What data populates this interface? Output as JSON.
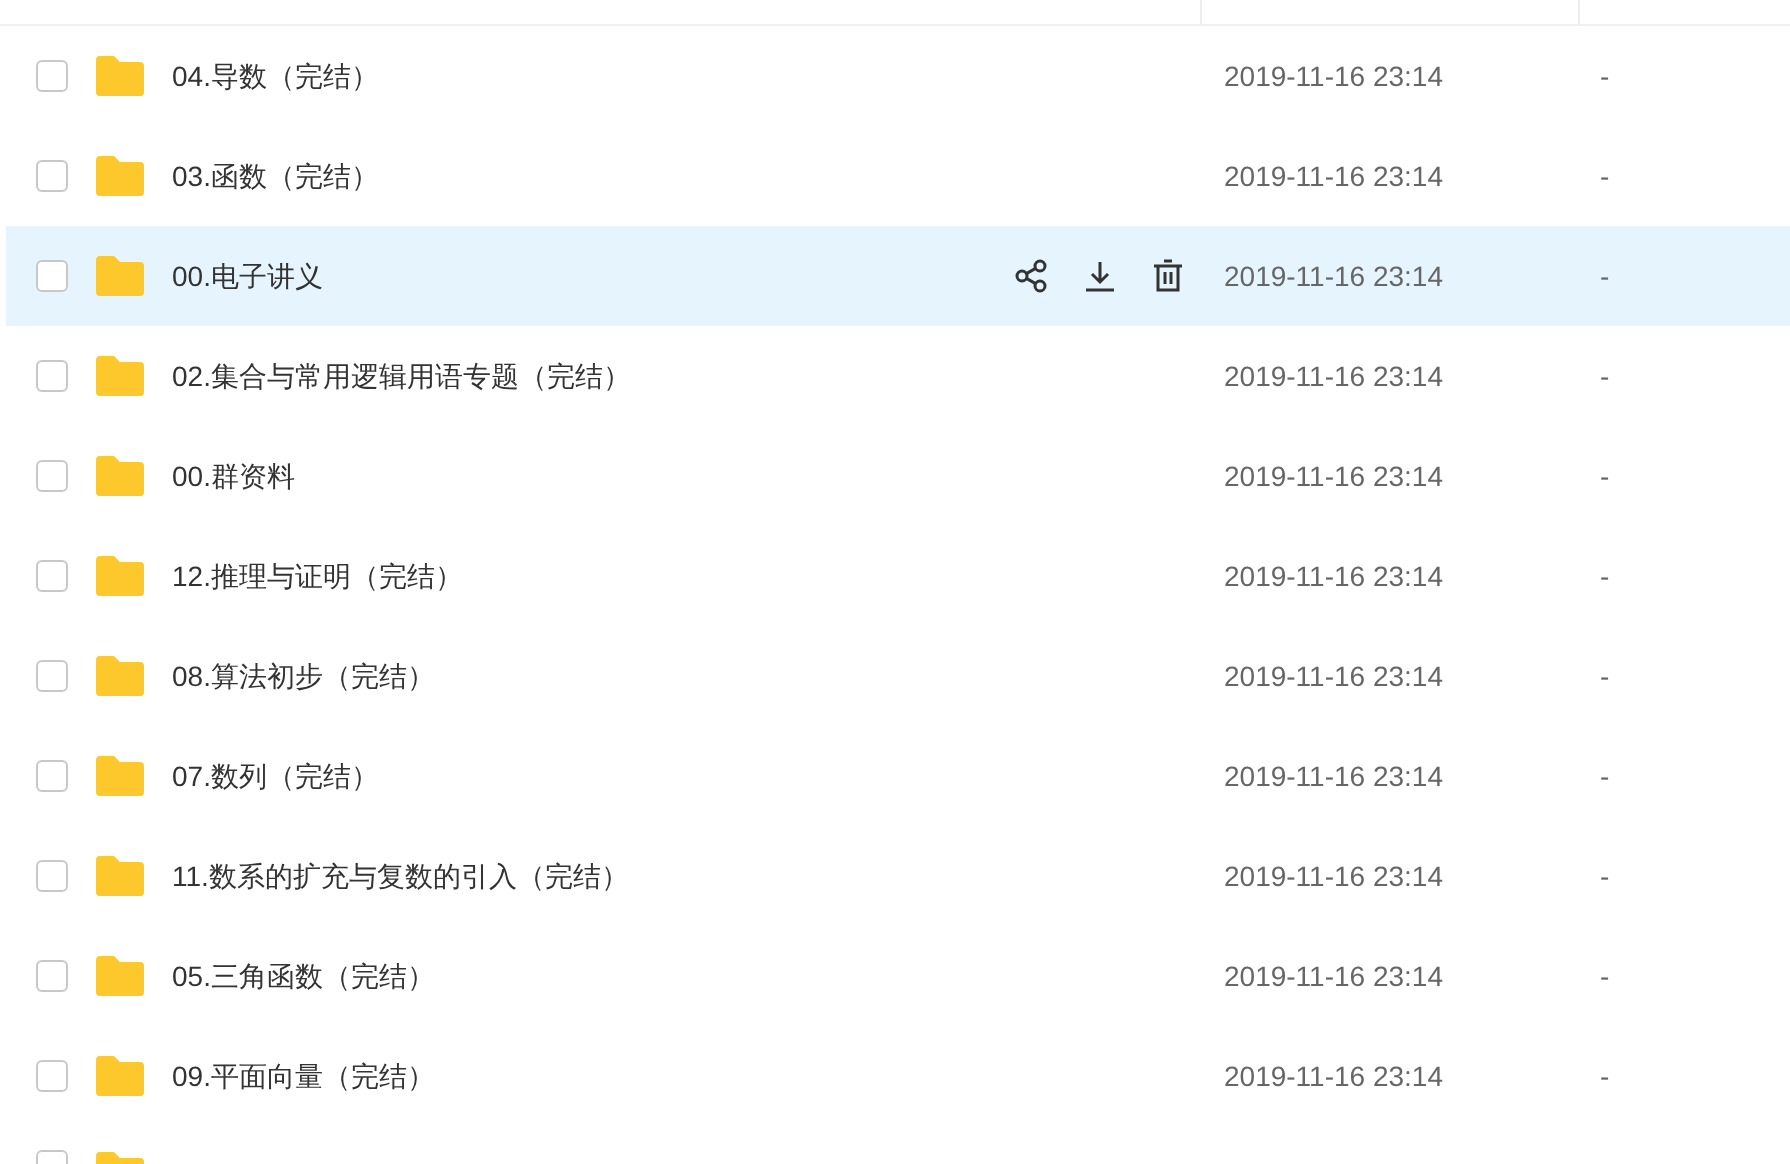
{
  "rows": [
    {
      "name": "04.导数（完结）",
      "modified": "2019-11-16 23:14",
      "size": "-",
      "checked": false,
      "hovered": false
    },
    {
      "name": "03.函数（完结）",
      "modified": "2019-11-16 23:14",
      "size": "-",
      "checked": false,
      "hovered": false
    },
    {
      "name": "00.电子讲义",
      "modified": "2019-11-16 23:14",
      "size": "-",
      "checked": false,
      "hovered": true
    },
    {
      "name": "02.集合与常用逻辑用语专题（完结）",
      "modified": "2019-11-16 23:14",
      "size": "-",
      "checked": false,
      "hovered": false
    },
    {
      "name": "00.群资料",
      "modified": "2019-11-16 23:14",
      "size": "-",
      "checked": false,
      "hovered": false
    },
    {
      "name": "12.推理与证明（完结）",
      "modified": "2019-11-16 23:14",
      "size": "-",
      "checked": false,
      "hovered": false
    },
    {
      "name": "08.算法初步（完结）",
      "modified": "2019-11-16 23:14",
      "size": "-",
      "checked": false,
      "hovered": false
    },
    {
      "name": "07.数列（完结）",
      "modified": "2019-11-16 23:14",
      "size": "-",
      "checked": false,
      "hovered": false
    },
    {
      "name": "11.数系的扩充与复数的引入（完结）",
      "modified": "2019-11-16 23:14",
      "size": "-",
      "checked": false,
      "hovered": false
    },
    {
      "name": "05.三角函数（完结）",
      "modified": "2019-11-16 23:14",
      "size": "-",
      "checked": false,
      "hovered": false
    },
    {
      "name": "09.平面向量（完结）",
      "modified": "2019-11-16 23:14",
      "size": "-",
      "checked": false,
      "hovered": false
    }
  ],
  "partial_row": {
    "checked": false
  }
}
